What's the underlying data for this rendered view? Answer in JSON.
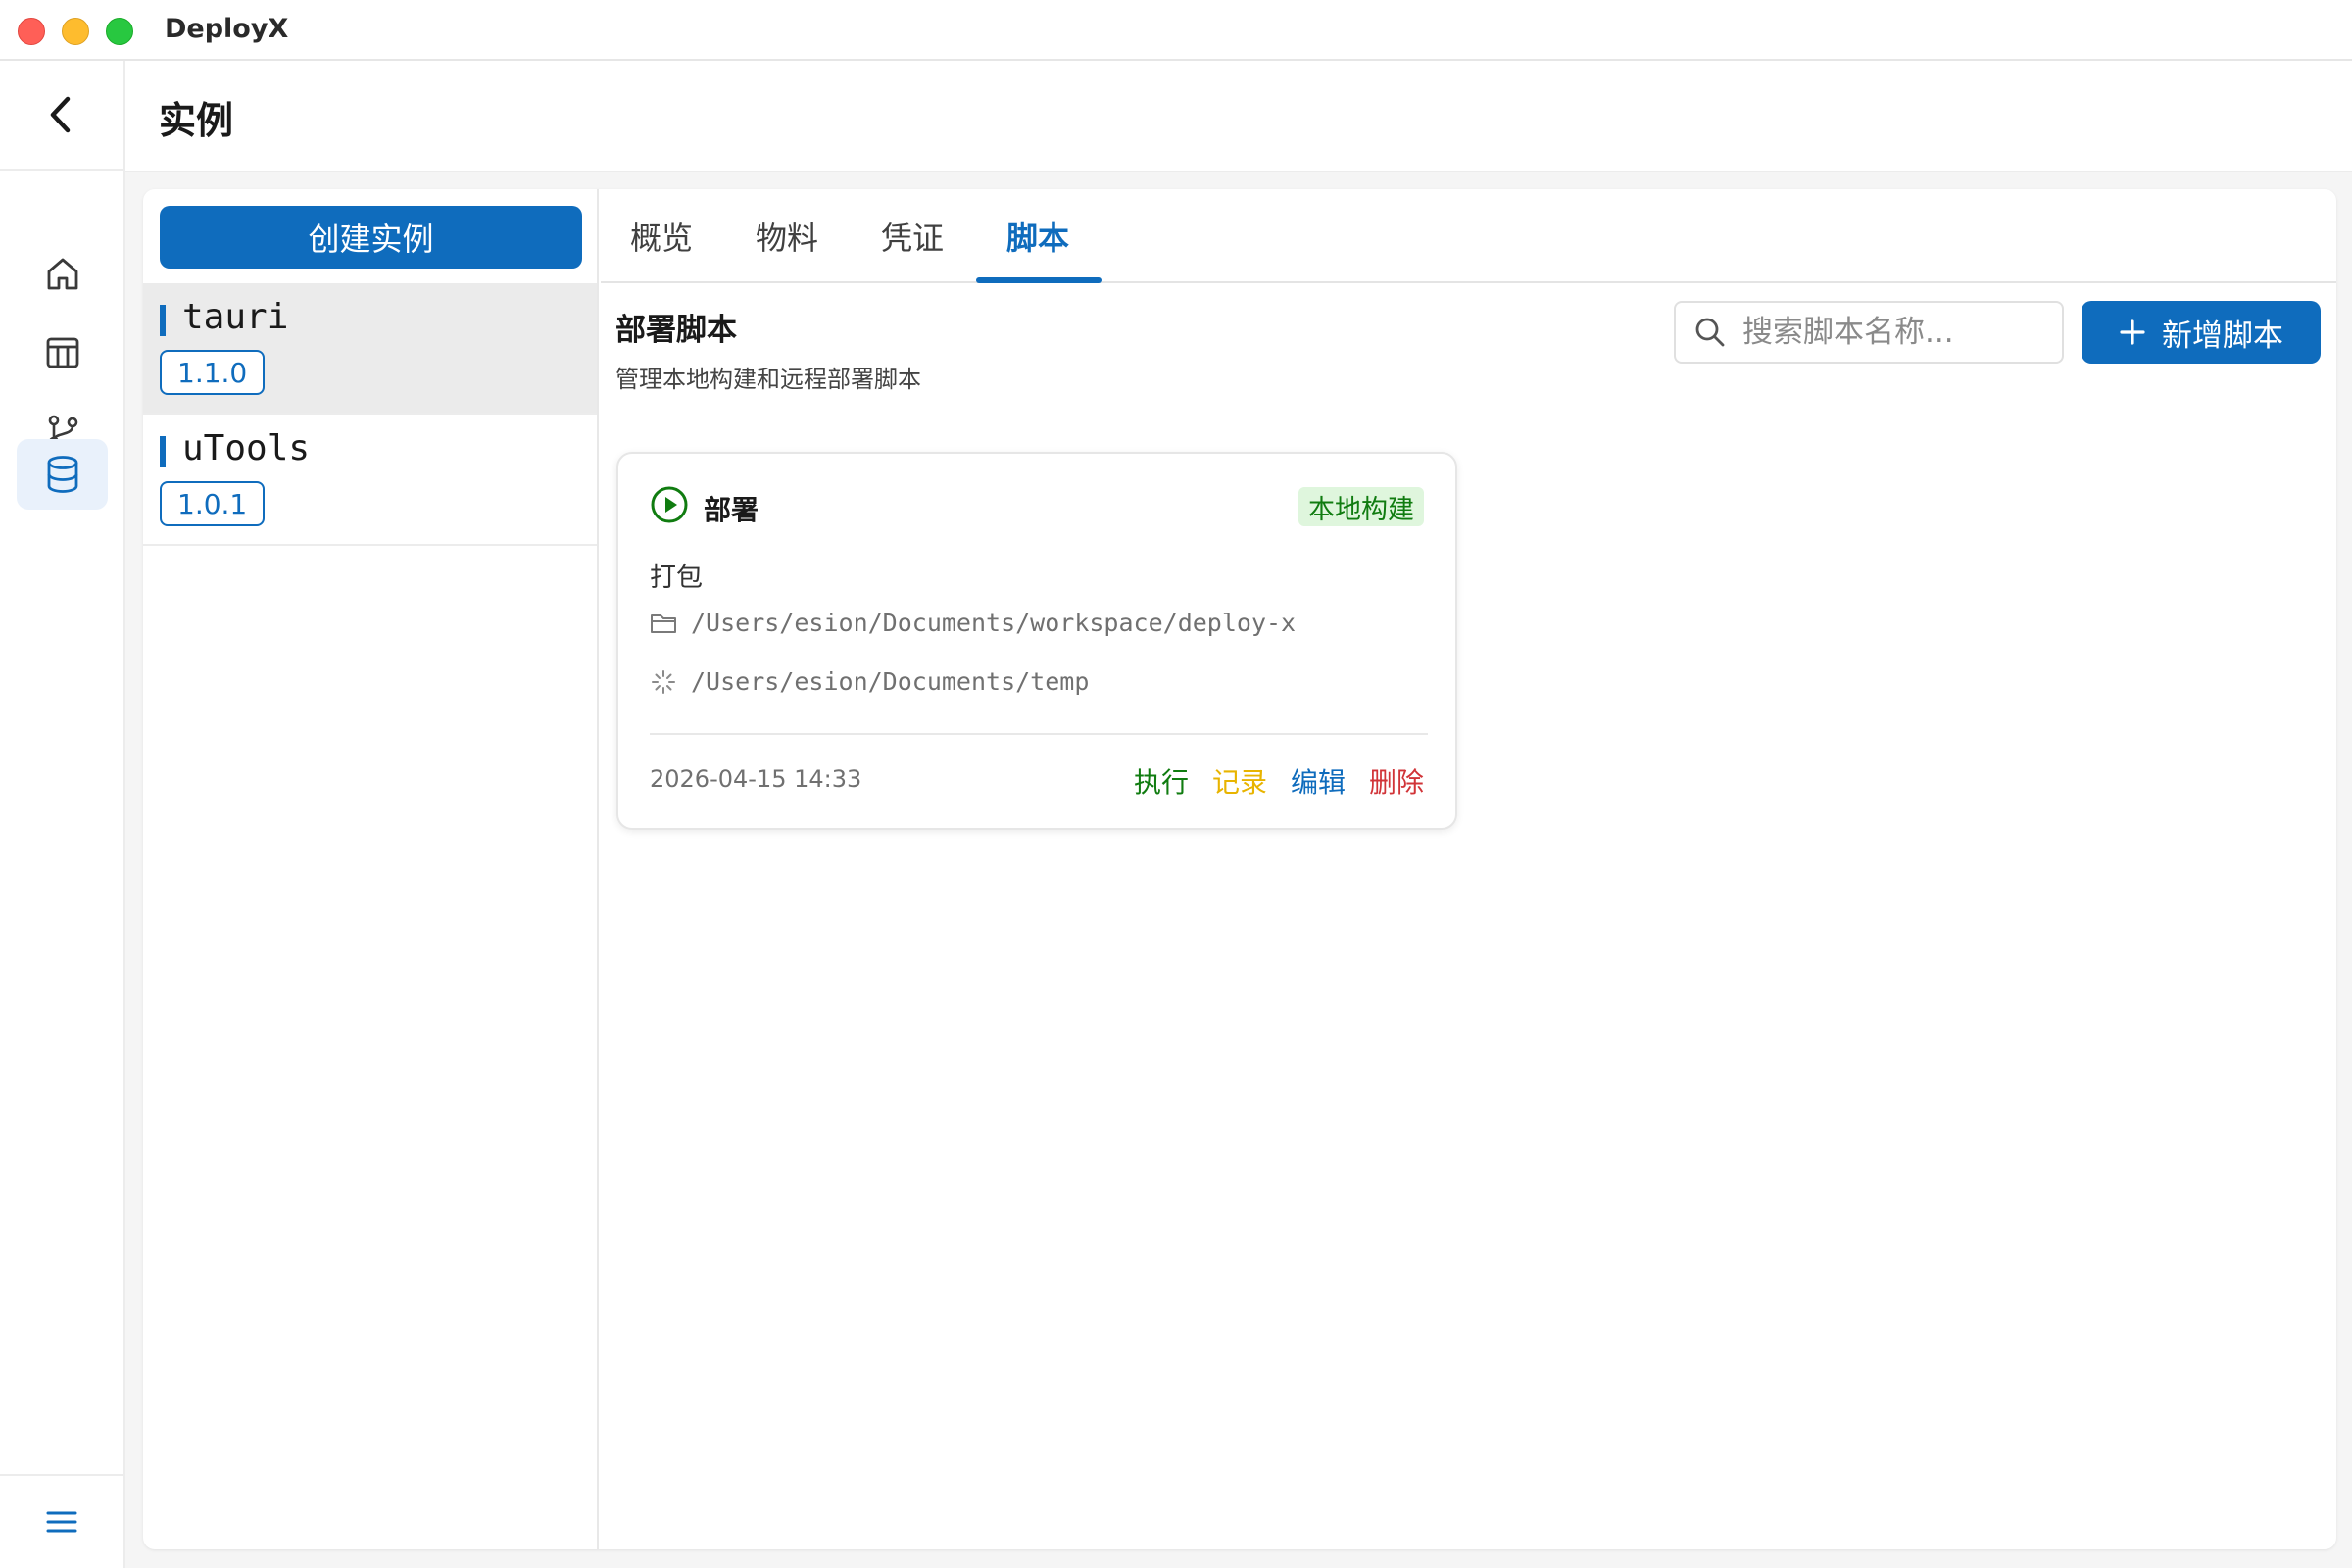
{
  "app": {
    "title": "DeployX"
  },
  "header": {
    "title": "实例"
  },
  "nav": {
    "items": [
      {
        "name": "home",
        "icon": "home-icon"
      },
      {
        "name": "table",
        "icon": "table-icon"
      },
      {
        "name": "branch",
        "icon": "git-branch-icon"
      },
      {
        "name": "database",
        "icon": "database-icon",
        "active": true
      }
    ],
    "bottom_icon": "menu-icon"
  },
  "instances": {
    "create_label": "创建实例",
    "items": [
      {
        "name": "tauri",
        "version": "1.1.0",
        "selected": true
      },
      {
        "name": "uTools",
        "version": "1.0.1",
        "selected": false
      }
    ]
  },
  "tabs": [
    {
      "label": "概览",
      "active": false
    },
    {
      "label": "物料",
      "active": false
    },
    {
      "label": "凭证",
      "active": false
    },
    {
      "label": "脚本",
      "active": true
    }
  ],
  "scripts": {
    "title": "部署脚本",
    "subtitle": "管理本地构建和远程部署脚本",
    "search_placeholder": "搜索脚本名称...",
    "add_label": "新增脚本",
    "cards": [
      {
        "title": "部署",
        "tag": "本地构建",
        "description": "打包",
        "work_dir": "/Users/esion/Documents/workspace/deploy-x",
        "output_dir": "/Users/esion/Documents/temp",
        "date": "2026-04-15 14:33",
        "actions": {
          "run": "执行",
          "log": "记录",
          "edit": "编辑",
          "delete": "删除"
        }
      }
    ]
  },
  "colors": {
    "accent": "#0f6cbd",
    "success": "#107c10",
    "warning": "#e8b400",
    "danger": "#d13438",
    "tag_bg": "#dff6dd"
  }
}
